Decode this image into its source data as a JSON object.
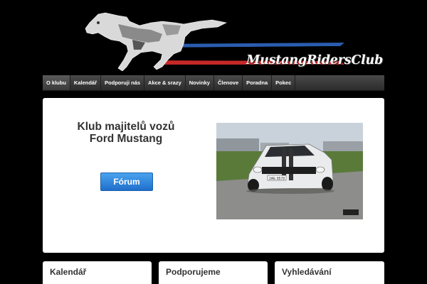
{
  "logo": {
    "text": "MustangRidersClub",
    "icon": "mustang-horse-logo"
  },
  "nav": {
    "items": [
      "O klubu",
      "Kalendář",
      "Podporuji nás",
      "Akce & srazy",
      "Novinky",
      "Členove",
      "Poradna",
      "Pokec"
    ]
  },
  "main": {
    "title_line1": "Klub majitelů vozů",
    "title_line2": "Ford Mustang",
    "forum_button": "Fórum",
    "photo_plate": "2AE 8578"
  },
  "widgets": {
    "calendar": "Kalendář",
    "support": "Podporujeme",
    "search": "Vyhledávání"
  },
  "colors": {
    "background": "#000000",
    "button_blue": "#2a7fd9",
    "stripe_blue": "#2a5db0",
    "stripe_red": "#c62828"
  }
}
